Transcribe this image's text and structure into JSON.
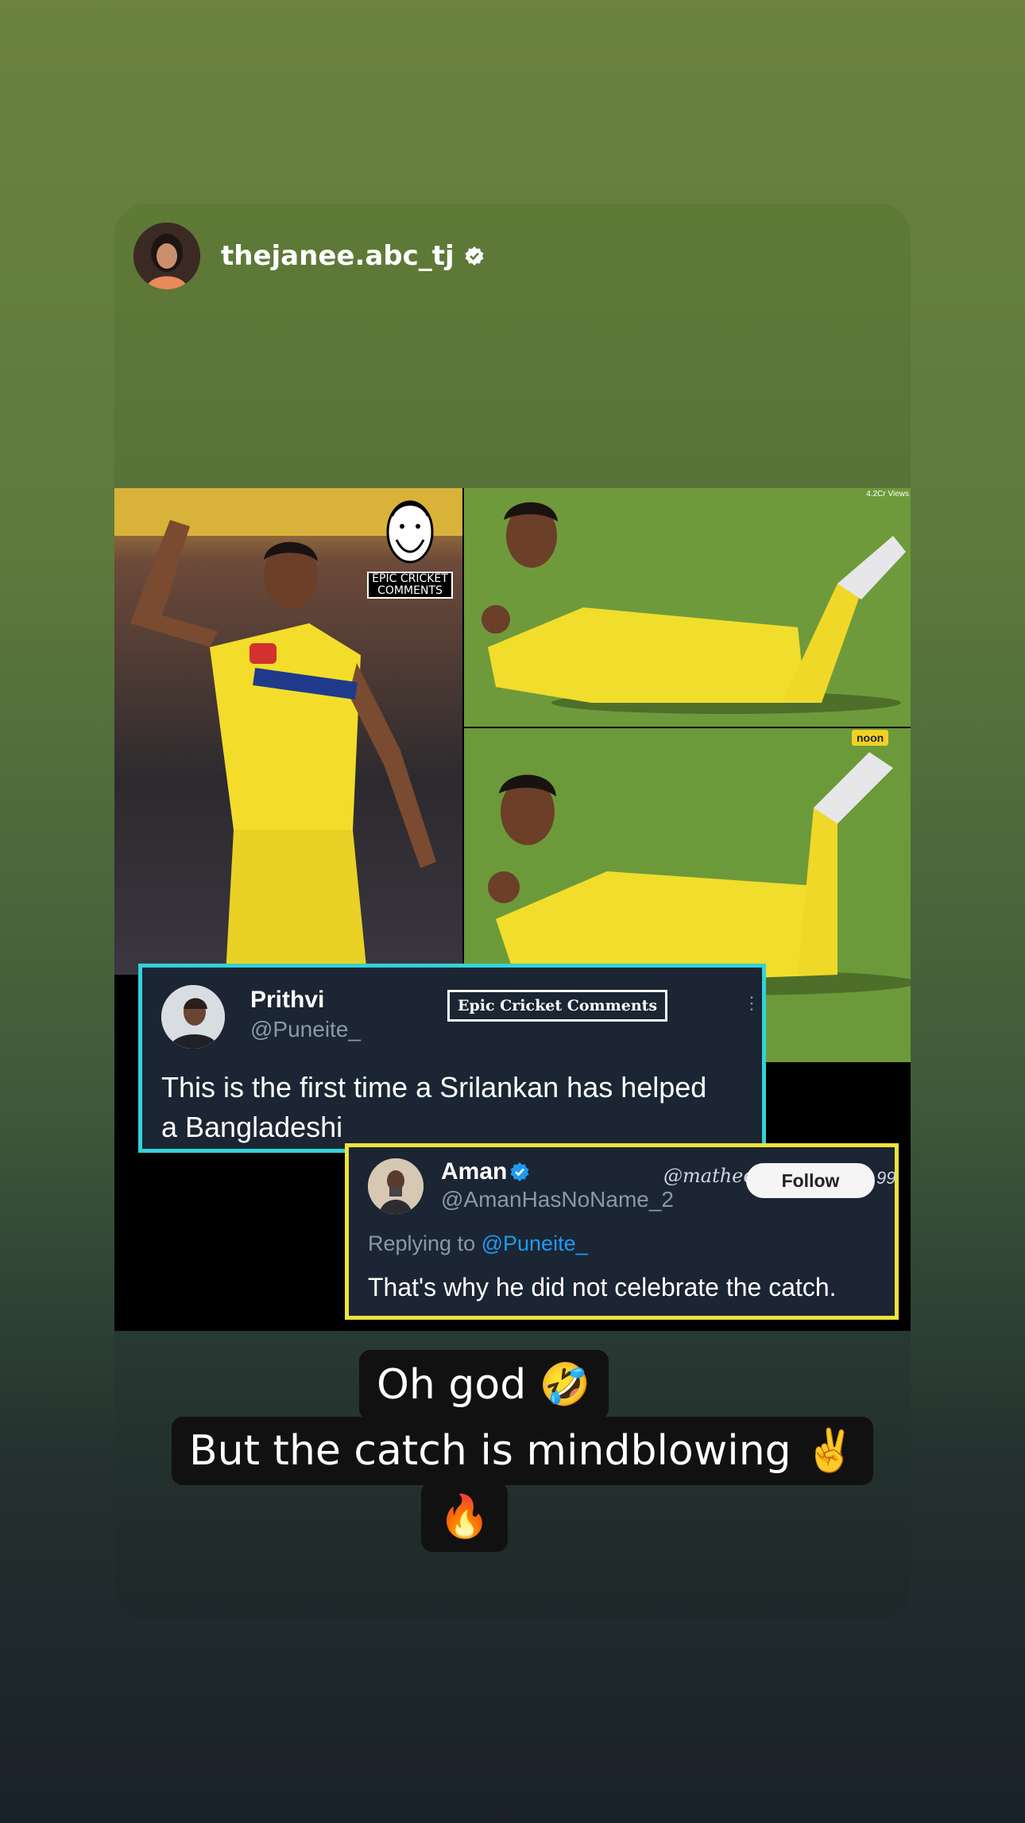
{
  "story": {
    "username": "thejanee.abc_tj",
    "verified_icon": "verified-badge-icon"
  },
  "post": {
    "watermark_top": "EPIC CRICKET",
    "watermark_bottom": "COMMENTS",
    "views_label": "4.2Cr Views",
    "sponsor_label": "noon"
  },
  "tweet1": {
    "name": "Prithvi",
    "handle": "@Puneite_",
    "badge": "Epic Cricket Comments",
    "text_line1": "This is the first time a Srilankan has helped",
    "text_line2": "a Bangladeshi"
  },
  "tweet2": {
    "name": "Aman",
    "handle": "@AmanHasNoName_2",
    "overlay_handle": "@mathee",
    "overlay_suffix": "99",
    "follow_label": "Follow",
    "replying_prefix": "Replying to",
    "replying_handle": "@Puneite_",
    "text": "That's why he did not celebrate the catch."
  },
  "caption": {
    "line1": "Oh god 🤣",
    "line2": "But the catch is mindblowing ✌️",
    "line3": "🔥"
  },
  "colors": {
    "tweet1_border": "#33d2d8",
    "tweet2_border": "#f0e239",
    "link_blue": "#1d9bf0"
  }
}
